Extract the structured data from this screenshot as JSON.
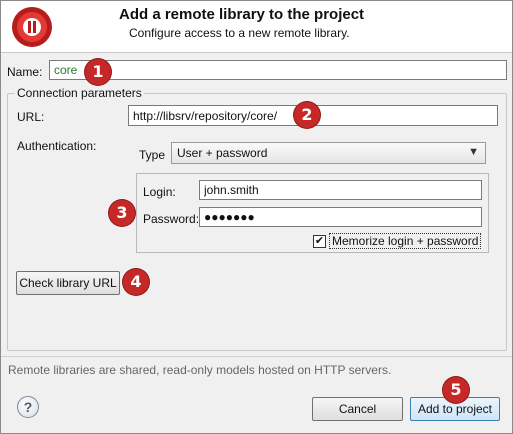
{
  "header": {
    "title": "Add a remote library to the project",
    "subtitle": "Configure access to a new remote library."
  },
  "name": {
    "label": "Name:",
    "value": "core"
  },
  "connection": {
    "legend": "Connection parameters",
    "url_label": "URL:",
    "url_value": "http://libsrv/repository/core/",
    "authentication_label": "Authentication:",
    "type_label": "Type",
    "type_value": "User + password",
    "login_label": "Login:",
    "login_value": "john.smith",
    "password_label": "Password:",
    "password_value": "●●●●●●●",
    "memorize_label": "Memorize login + password",
    "memorize_checked": true,
    "check_url_label": "Check library URL"
  },
  "footer": {
    "note": "Remote libraries are shared, read-only models hosted on HTTP servers.",
    "help_glyph": "?",
    "cancel_label": "Cancel",
    "add_label": "Add to project"
  },
  "callouts": [
    "1",
    "2",
    "3",
    "4",
    "5"
  ],
  "icons": {
    "logo": "app-logo-icon",
    "help": "help-icon",
    "dropdown": "chevron-down-icon",
    "check": "checkmark-icon"
  },
  "colors": {
    "callout": "#c62828",
    "name_text": "#2a7a2a",
    "default_button_border": "#3c7fb1"
  }
}
